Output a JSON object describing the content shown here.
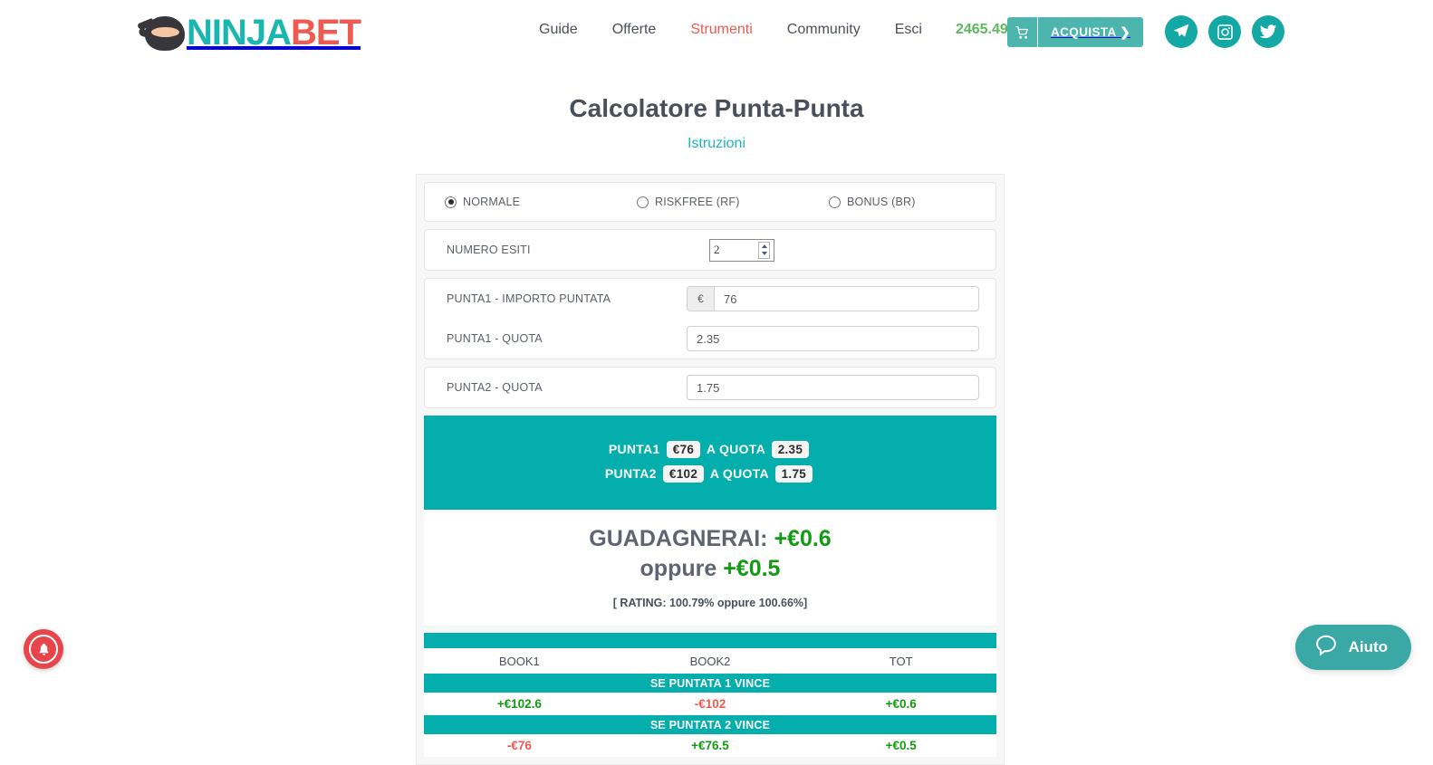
{
  "header": {
    "logo": {
      "part_teal": "NINJA",
      "part_red": "BET",
      "icon": "ninja-head-icon"
    },
    "nav": [
      {
        "label": "Guide",
        "active": false
      },
      {
        "label": "Offerte",
        "active": false
      },
      {
        "label": "Strumenti",
        "active": true
      },
      {
        "label": "Community",
        "active": false
      },
      {
        "label": "Esci",
        "active": false
      }
    ],
    "balance": "2465.49 €",
    "buy_button": {
      "label": "ACQUISTA ❯",
      "icon": "cart-icon"
    },
    "socials": [
      {
        "name": "telegram-icon"
      },
      {
        "name": "instagram-icon"
      },
      {
        "name": "twitter-icon"
      }
    ],
    "colors": {
      "teal": "#1ab7b1",
      "red": "#ef5b52",
      "green": "#5cb860",
      "buy_bg": "#4cb5ae"
    }
  },
  "page": {
    "title": "Calcolatore Punta-Punta",
    "instructions_link": "Istruzioni"
  },
  "calculator": {
    "modes": [
      {
        "label": "NORMALE",
        "selected": true
      },
      {
        "label": "RISKFREE (RF)",
        "selected": false
      },
      {
        "label": "BONUS (BR)",
        "selected": false
      }
    ],
    "numero_esiti": {
      "label": "NUMERO ESITI",
      "value": "2"
    },
    "fields": [
      {
        "label": "PUNTA1 - IMPORTO PUNTATA",
        "addon": "€",
        "value": "76"
      },
      {
        "label": "PUNTA1 - QUOTA",
        "addon": "",
        "value": "2.35"
      },
      {
        "label": "PUNTA2 - QUOTA",
        "addon": "",
        "value": "1.75"
      }
    ]
  },
  "result": {
    "bets": [
      {
        "name": "PUNTA1",
        "amount": "€76",
        "at_label": "A QUOTA",
        "odds": "2.35"
      },
      {
        "name": "PUNTA2",
        "amount": "€102",
        "at_label": "A QUOTA",
        "odds": "1.75"
      }
    ],
    "gain_label": "GUADAGNERAI:",
    "gain_value_1": "+€0.6",
    "or_label": "oppure",
    "gain_value_2": "+€0.5",
    "rating": "[ RATING: 100.79% oppure 100.66%]",
    "colors": {
      "panel_teal": "#04aeac",
      "positive": "#139a13",
      "negative": "#ee5a52"
    }
  },
  "table": {
    "headers": [
      "BOOK1",
      "BOOK2",
      "TOT"
    ],
    "sections": [
      {
        "title": "SE PUNTATA 1 VINCE",
        "values": [
          {
            "text": "+€102.6",
            "sign": "pos"
          },
          {
            "text": "-€102",
            "sign": "neg"
          },
          {
            "text": "+€0.6",
            "sign": "pos"
          }
        ]
      },
      {
        "title": "SE PUNTATA 2 VINCE",
        "values": [
          {
            "text": "-€76",
            "sign": "neg"
          },
          {
            "text": "+€76.5",
            "sign": "pos"
          },
          {
            "text": "+€0.5",
            "sign": "pos"
          }
        ]
      }
    ]
  },
  "floating": {
    "notification": {
      "name": "notification-bell-icon"
    },
    "help": {
      "label": "Aiuto",
      "icon": "chat-bubble-icon"
    }
  }
}
